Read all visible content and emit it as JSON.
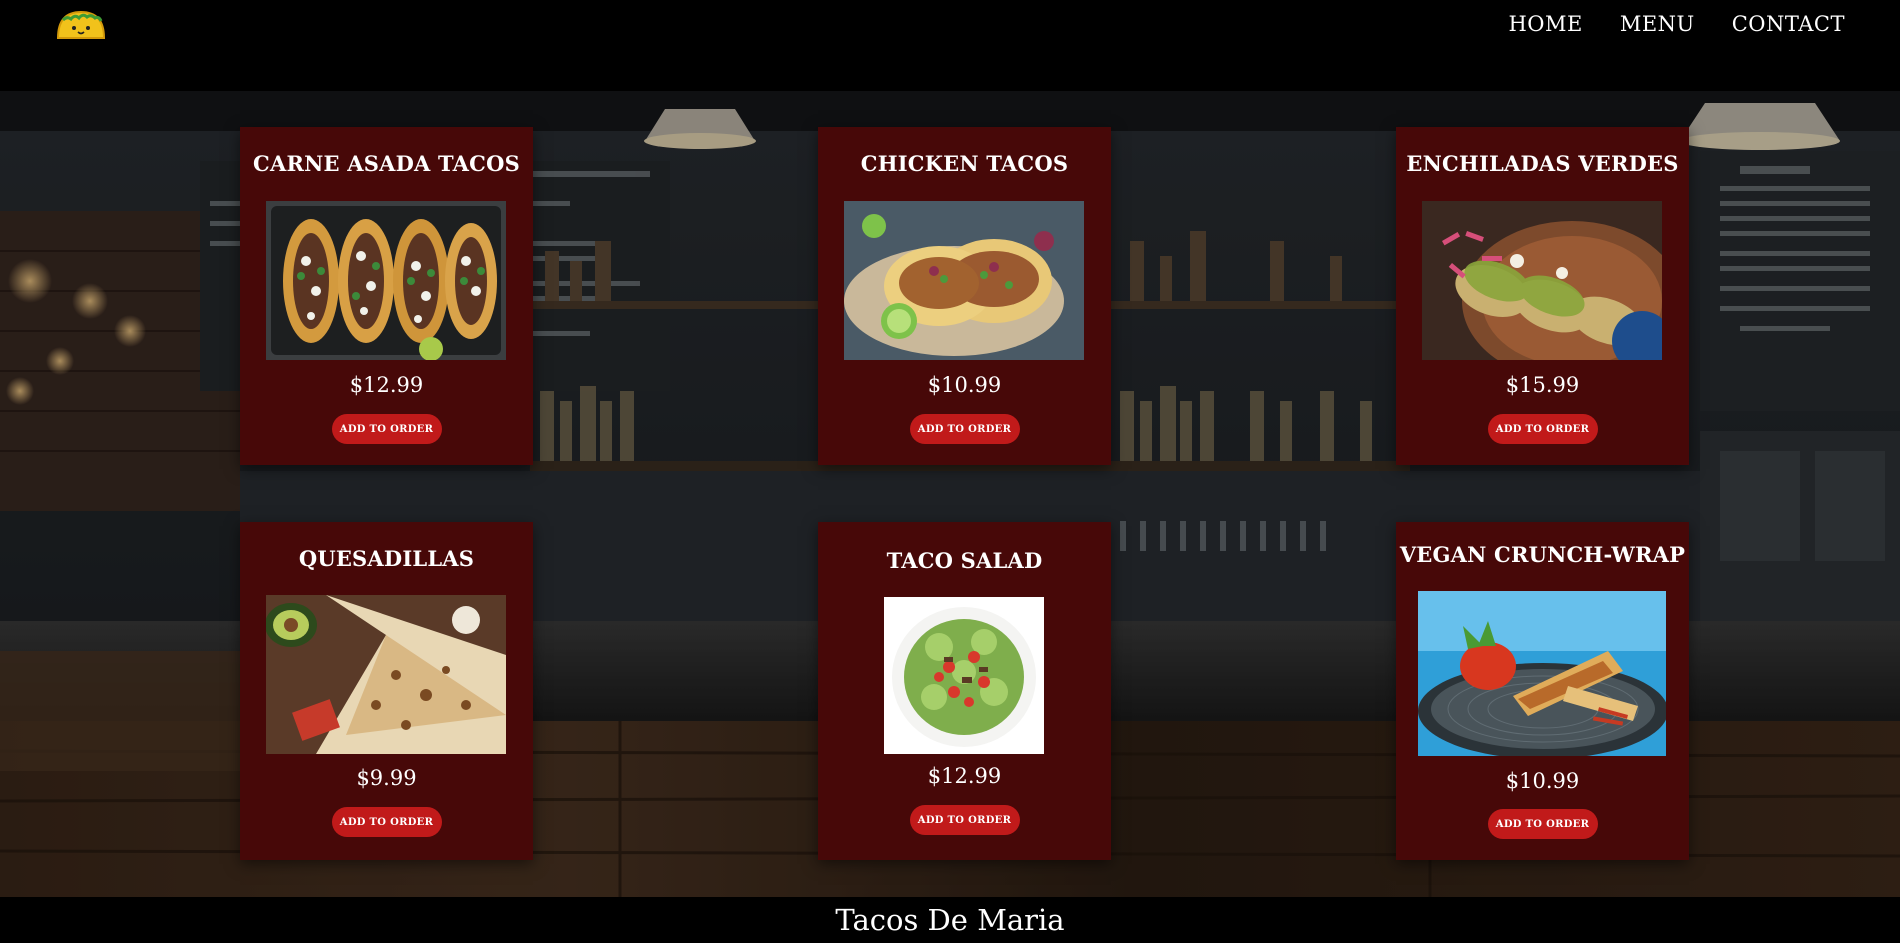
{
  "brand": {
    "logo_icon": "taco-icon"
  },
  "nav": {
    "items": [
      {
        "label": "HOME"
      },
      {
        "label": "MENU"
      },
      {
        "label": "CONTACT"
      }
    ]
  },
  "colors": {
    "card_bg": "#470808",
    "button_bg": "#c11a1a",
    "header_bg": "#000000"
  },
  "menu": {
    "items": [
      {
        "title": "CARNE ASADA TACOS",
        "price": "$12.99",
        "button": "ADD TO ORDER",
        "image": "carne-asada-tacos-photo"
      },
      {
        "title": "CHICKEN TACOS",
        "price": "$10.99",
        "button": "ADD TO ORDER",
        "image": "chicken-tacos-photo"
      },
      {
        "title": "ENCHILADAS VERDES",
        "price": "$15.99",
        "button": "ADD TO ORDER",
        "image": "enchiladas-verdes-photo"
      },
      {
        "title": "QUESADILLAS",
        "price": "$9.99",
        "button": "ADD TO ORDER",
        "image": "quesadillas-photo"
      },
      {
        "title": "TACO SALAD",
        "price": "$12.99",
        "button": "ADD TO ORDER",
        "image": "taco-salad-photo"
      },
      {
        "title": "VEGAN CRUNCH-WRAP",
        "price": "$10.99",
        "button": "ADD TO ORDER",
        "image": "vegan-crunch-wrap-photo"
      }
    ]
  },
  "footer": {
    "text": "Tacos De Maria"
  }
}
